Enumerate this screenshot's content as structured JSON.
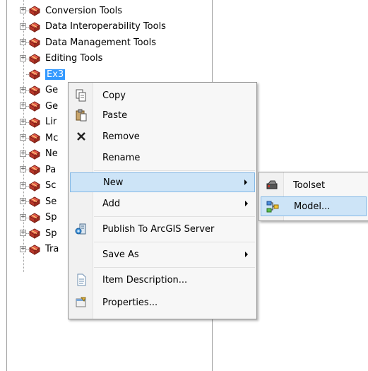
{
  "tree": {
    "items": [
      {
        "label": "Conversion Tools",
        "expandable": true
      },
      {
        "label": "Data Interoperability Tools",
        "expandable": true
      },
      {
        "label": "Data Management Tools",
        "expandable": true
      },
      {
        "label": "Editing Tools",
        "expandable": true
      },
      {
        "label": "Ex3",
        "expandable": false,
        "selected": true
      },
      {
        "label": "Ge",
        "expandable": true
      },
      {
        "label": "Ge",
        "expandable": true
      },
      {
        "label": "Lir",
        "expandable": true
      },
      {
        "label": "Mc",
        "expandable": true
      },
      {
        "label": "Ne",
        "expandable": true
      },
      {
        "label": "Pa",
        "expandable": true
      },
      {
        "label": "Sc",
        "expandable": true
      },
      {
        "label": "Se",
        "expandable": true
      },
      {
        "label": "Sp",
        "expandable": true
      },
      {
        "label": "Sp",
        "expandable": true
      },
      {
        "label": "Tra",
        "expandable": true
      }
    ],
    "expander_symbol": "+"
  },
  "context_menu": {
    "items": [
      {
        "label": "Copy",
        "icon": "copy-icon"
      },
      {
        "label": "Paste",
        "icon": "paste-icon"
      },
      {
        "label": "Remove",
        "icon": "remove-icon"
      },
      {
        "label": "Rename",
        "icon": ""
      },
      {
        "label": "New",
        "icon": "",
        "submenu": true,
        "highlighted": true
      },
      {
        "label": "Add",
        "icon": "",
        "submenu": true
      },
      {
        "label": "Publish To ArcGIS Server",
        "icon": "publish-icon"
      },
      {
        "label": "Save As",
        "icon": "",
        "submenu": true
      },
      {
        "label": "Item Description...",
        "icon": "item-description-icon"
      },
      {
        "label": "Properties...",
        "icon": "properties-icon"
      }
    ]
  },
  "submenu": {
    "items": [
      {
        "label": "Toolset",
        "icon": "toolset-icon"
      },
      {
        "label": "Model...",
        "icon": "model-icon",
        "highlighted": true
      }
    ]
  },
  "colors": {
    "selection": "#3399ff",
    "menu_highlight": "#cde4f7",
    "menu_highlight_border": "#83b8e6",
    "toolbox_red": "#c0392b"
  }
}
